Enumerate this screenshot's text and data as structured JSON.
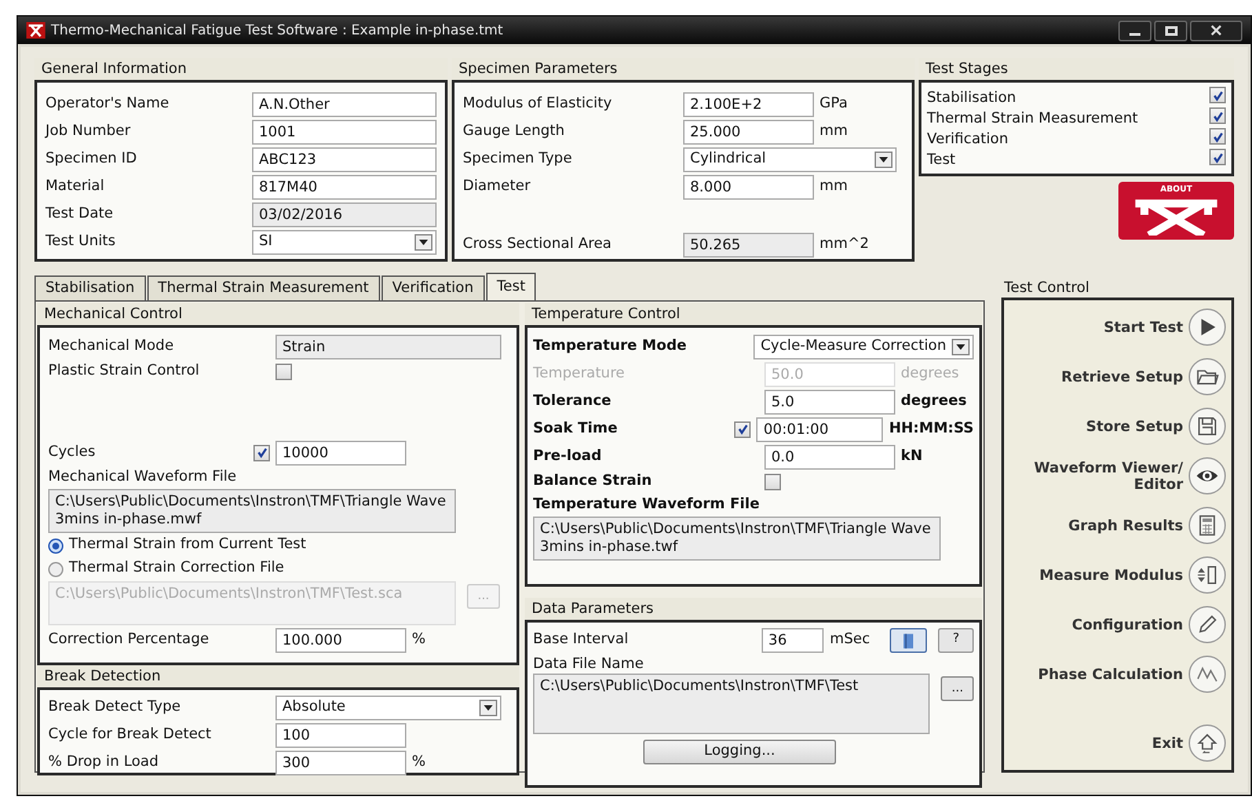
{
  "window": {
    "title": "Thermo-Mechanical Fatigue Test Software : Example in-phase.tmt"
  },
  "general_information": {
    "title": "General Information",
    "fields": [
      {
        "label": "Operator's Name",
        "value": "A.N.Other",
        "kind": "text"
      },
      {
        "label": "Job Number",
        "value": "1001",
        "kind": "text"
      },
      {
        "label": "Specimen ID",
        "value": "ABC123",
        "kind": "text"
      },
      {
        "label": "Material",
        "value": "817M40",
        "kind": "text"
      },
      {
        "label": "Test Date",
        "value": "03/02/2016",
        "kind": "readonly"
      },
      {
        "label": "Test Units",
        "value": "SI",
        "kind": "dropdown"
      }
    ]
  },
  "specimen_parameters": {
    "title": "Specimen Parameters",
    "fields": [
      {
        "label": "Modulus of Elasticity",
        "value": "2.100E+2",
        "unit": "GPa",
        "kind": "text"
      },
      {
        "label": "Gauge Length",
        "value": "25.000",
        "unit": "mm",
        "kind": "text"
      },
      {
        "label": "Specimen Type",
        "value": "Cylindrical",
        "kind": "dropdown"
      },
      {
        "label": "Diameter",
        "value": "8.000",
        "unit": "mm",
        "kind": "text"
      },
      {
        "label": "Cross Sectional Area",
        "value": "50.265",
        "unit": "mm^2",
        "kind": "readonly"
      }
    ]
  },
  "test_stages": {
    "title": "Test Stages",
    "items": [
      {
        "label": "Stabilisation",
        "checked": true
      },
      {
        "label": "Thermal Strain Measurement",
        "checked": true
      },
      {
        "label": "Verification",
        "checked": true
      },
      {
        "label": "Test",
        "checked": true
      }
    ]
  },
  "about_logo": {
    "label": "ABOUT"
  },
  "tabs": [
    {
      "label": "Stabilisation",
      "selected": false
    },
    {
      "label": "Thermal Strain Measurement",
      "selected": false
    },
    {
      "label": "Verification",
      "selected": false
    },
    {
      "label": "Test",
      "selected": true
    }
  ],
  "mechanical_control": {
    "title": "Mechanical Control",
    "rows": [
      {
        "kind": "readonly",
        "label": "Mechanical Mode",
        "value": "Strain",
        "disabled": false
      },
      {
        "kind": "checkbox",
        "label": "Plastic Strain Control",
        "checked": false,
        "disabled": false
      },
      {
        "kind": "check_text",
        "label": "Cycles",
        "checked": true,
        "value": "10000",
        "disabled": false
      },
      {
        "kind": "heading",
        "label": "Mechanical Waveform File",
        "disabled": false
      },
      {
        "kind": "file",
        "value": "C:\\Users\\Public\\Documents\\Instron\\TMF\\Triangle Wave 3mins in-phase.mwf",
        "disabled": false
      },
      {
        "kind": "radio",
        "label": "Thermal Strain from Current Test",
        "selected": true,
        "disabled": false
      },
      {
        "kind": "radio",
        "label": "Thermal Strain Correction File",
        "selected": false,
        "disabled": false
      },
      {
        "kind": "file",
        "value": "C:\\Users\\Public\\Documents\\Instron\\TMF\\Test.sca",
        "browse": "...",
        "disabled": true
      },
      {
        "kind": "text",
        "label": "Correction Percentage",
        "value": "100.000",
        "unit": "%",
        "disabled": false
      }
    ]
  },
  "break_detection": {
    "title": "Break Detection",
    "rows": [
      {
        "kind": "dropdown",
        "label": "Break Detect Type",
        "value": "Absolute",
        "disabled": false
      },
      {
        "kind": "text",
        "label": "Cycle for Break Detect",
        "value": "100",
        "disabled": false
      },
      {
        "kind": "text",
        "label": "% Drop in Load",
        "value": "300",
        "unit": "%",
        "disabled": false
      }
    ]
  },
  "temperature_control": {
    "title": "Temperature Control",
    "rows": [
      {
        "kind": "dropdown",
        "label": "Temperature Mode",
        "value": "Cycle-Measure Correction",
        "disabled": false
      },
      {
        "kind": "text",
        "label": "Temperature",
        "value": "50.0",
        "unit": "degrees",
        "disabled": true
      },
      {
        "kind": "text",
        "label": "Tolerance",
        "value": "5.0",
        "unit": "degrees",
        "disabled": false
      },
      {
        "kind": "check_text",
        "label": "Soak Time",
        "checked": true,
        "value": "00:01:00",
        "unit": "HH:MM:SS",
        "disabled": false
      },
      {
        "kind": "text",
        "label": "Pre-load",
        "value": "0.0",
        "unit": "kN",
        "disabled": false
      },
      {
        "kind": "checkbox",
        "label": "Balance Strain",
        "checked": false,
        "disabled": false
      },
      {
        "kind": "heading",
        "label": "Temperature Waveform File",
        "disabled": false
      },
      {
        "kind": "file",
        "value": "C:\\Users\\Public\\Documents\\Instron\\TMF\\Triangle Wave 3mins in-phase.twf",
        "disabled": false
      }
    ]
  },
  "data_parameters": {
    "title": "Data Parameters",
    "base_interval": {
      "label": "Base Interval",
      "value": "36",
      "unit": "mSec",
      "help": "?"
    },
    "data_file": {
      "label": "Data File Name",
      "value": "C:\\Users\\Public\\Documents\\Instron\\TMF\\Test",
      "browse": "..."
    },
    "logging_button": "Logging..."
  },
  "test_control": {
    "title": "Test Control",
    "buttons": [
      "Start Test",
      "Retrieve Setup",
      "Store Setup",
      "Waveform Viewer/ Editor",
      "Graph Results",
      "Measure Modulus",
      "Configuration",
      "Phase Calculation",
      "Exit"
    ]
  }
}
